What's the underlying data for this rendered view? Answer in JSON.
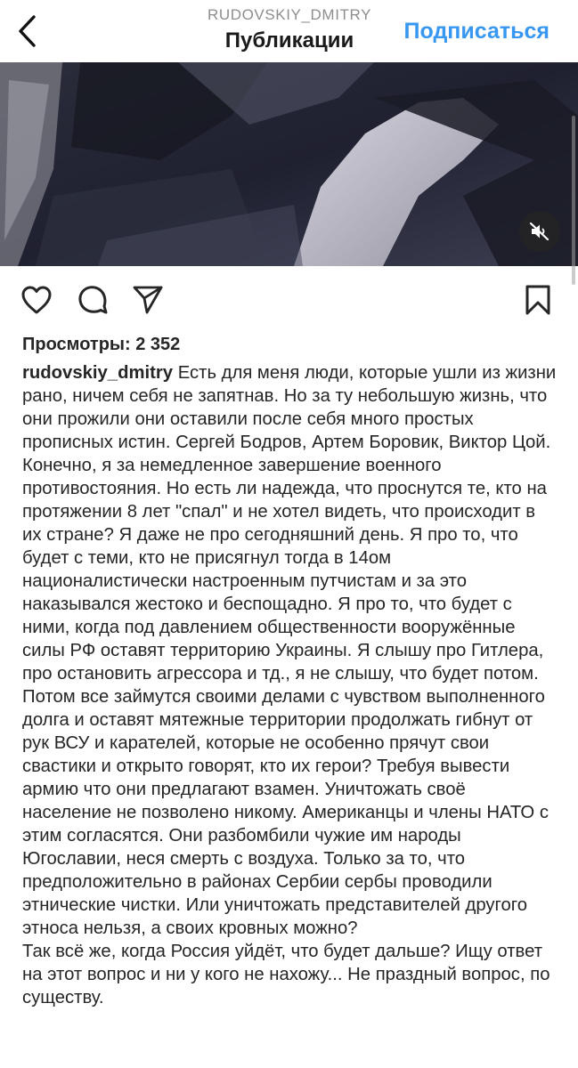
{
  "header": {
    "username": "RUDOVSKIY_DMITRY",
    "title": "Публикации",
    "subscribe_label": "Подписаться"
  },
  "icons": {
    "back": "chevron-left-icon",
    "mute": "speaker-muted-icon",
    "like": "heart-icon",
    "comment": "comment-bubble-icon",
    "share": "paper-plane-icon",
    "save": "bookmark-icon"
  },
  "colors": {
    "accent": "#3897f0",
    "text": "#262626",
    "muted": "#8e8e8e"
  },
  "post": {
    "views_text": "Просмотры: 2 352",
    "author": "rudovskiy_dmitry",
    "caption_first": "Есть для меня люди, которые ушли из жизни рано, ничем себя не запятнав. Но за ту небольшую жизнь, что они прожили они оставили после себя много простых прописных истин. Сергей Бодров, Артем Боровик,  Виктор Цой. Конечно,  я за немедленное завершение  военного противостояния. Но есть ли  надежда, что проснутся те, кто на протяжении 8 лет \"спал\" и не хотел видеть, что происходит в их стране? Я даже не про сегодняшний день. Я про то, что будет с теми, кто не присягнул тогда в 14ом националистически настроенным путчистам и за это наказывался жестоко и беспощадно.  Я про то, что будет с ними, когда под давлением общественности вооружённые силы РФ оставят территорию Украины. Я слышу про Гитлера, про остановить агрессора и тд., я не слышу, что будет потом. Потом все займутся своими делами с чувством выполненного долга и оставят мятежные территории продолжать гибнут от рук ВСУ и карателей,  которые не особенно прячут свои свастики и открыто говорят, кто их герои?  Требуя вывести армию  что они предлагают взамен. Уничтожать своё население не позволено никому. Американцы и члены НАТО с этим согласятся. Они разбомбили чужие им народы Югославии, неся смерть с воздуха. Только за то, что предположительно в районах Сербии сербы проводили этнические чистки. Или уничтожать  представителей другого этноса нельзя, а своих кровных можно?",
    "caption_second": "Так всё же,  когда  Россия уйдёт, что будет дальше? Ищу ответ на этот вопрос и ни у кого не нахожу... Не праздный вопрос, по существу."
  }
}
